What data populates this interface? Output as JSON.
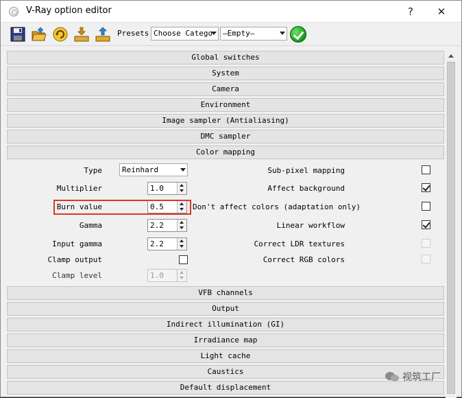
{
  "window": {
    "title": "V-Ray option editor",
    "help_label": "?",
    "close_label": "✕"
  },
  "toolbar": {
    "icons": [
      "save-icon",
      "open-folder-icon",
      "reset-icon",
      "load-preset-icon",
      "save-preset-icon"
    ],
    "presets_label": "Presets:",
    "category_value": "Choose Catego",
    "preset_value": "—Empty—",
    "apply_icon": "check-icon"
  },
  "rollouts_top": [
    "Global switches",
    "System",
    "Camera",
    "Environment",
    "Image sampler (Antialiasing)",
    "DMC sampler",
    "Color mapping"
  ],
  "color_mapping": {
    "type_label": "Type",
    "type_value": "Reinhard",
    "multiplier_label": "Multiplier",
    "multiplier_value": "1.0",
    "burn_label": "Burn value",
    "burn_value": "0.5",
    "gamma_label": "Gamma",
    "gamma_value": "2.2",
    "input_gamma_label": "Input gamma",
    "input_gamma_value": "2.2",
    "clamp_output_label": "Clamp output",
    "clamp_output_checked": false,
    "clamp_level_label": "Clamp level",
    "clamp_level_value": "1.0",
    "subpixel_label": "Sub-pixel mapping",
    "subpixel_checked": false,
    "affect_bg_label": "Affect background",
    "affect_bg_checked": true,
    "dont_affect_label": "Don't affect colors (adaptation only)",
    "dont_affect_checked": false,
    "linear_label": "Linear workflow",
    "linear_checked": true,
    "correct_ldr_label": "Correct LDR textures",
    "correct_rgb_label": "Correct RGB colors"
  },
  "rollouts_bottom": [
    "VFB channels",
    "Output",
    "Indirect illumination (GI)",
    "Irradiance map",
    "Light cache",
    "Caustics",
    "Default displacement"
  ],
  "watermark": "视筑工厂",
  "colors": {
    "highlight": "#d9362b",
    "apply_green": "#159a15"
  }
}
